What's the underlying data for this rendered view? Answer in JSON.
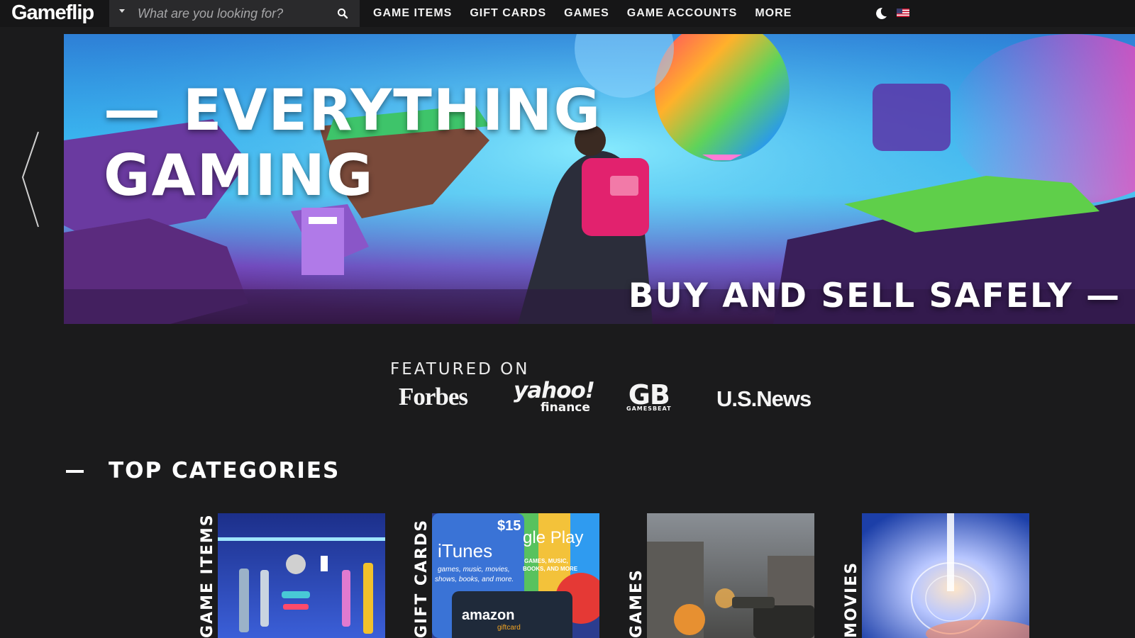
{
  "brand": {
    "logo_text": "Gameflip"
  },
  "search": {
    "placeholder": "What are you looking for?"
  },
  "nav": {
    "items": [
      "GAME ITEMS",
      "GIFT CARDS",
      "GAMES",
      "GAME ACCOUNTS",
      "MORE"
    ]
  },
  "icons": {
    "search": "search-icon",
    "theme_toggle": "moon-icon",
    "language": "us-flag-icon",
    "carousel_prev": "chevron-left-icon"
  },
  "hero": {
    "title_line1": "— EVERYTHING",
    "title_line2": "GAMING",
    "tagline": "BUY AND SELL SAFELY —"
  },
  "featured": {
    "heading": "FEATURED ON",
    "press": {
      "forbes": "Forbes",
      "yahoo_main": "yahoo!",
      "yahoo_sub": "finance",
      "gb_main": "GB",
      "gb_sub": "GAMESBEAT",
      "usnews": "U.S.News"
    }
  },
  "categories": {
    "heading": "TOP CATEGORIES",
    "items": [
      {
        "label": "GAME ITEMS"
      },
      {
        "label": "GIFT CARDS"
      },
      {
        "label": "GAMES"
      },
      {
        "label": "MOVIES"
      }
    ],
    "gift_card_texts": {
      "price": "$15",
      "itunes": "iTunes",
      "itunes_sub1": "games, music, movies,",
      "itunes_sub2": "shows, books, and more.",
      "google_play": "gle Play",
      "google_sub1": "GAMES, MUSIC,",
      "google_sub2": "BOOKS, AND MORE",
      "amazon": "amazon",
      "amazon_sub": "giftcard"
    }
  },
  "colors": {
    "page_bg": "#1b1b1c",
    "nav_bg": "#161617",
    "search_bg": "#2a2a2c",
    "text": "#ffffff"
  }
}
